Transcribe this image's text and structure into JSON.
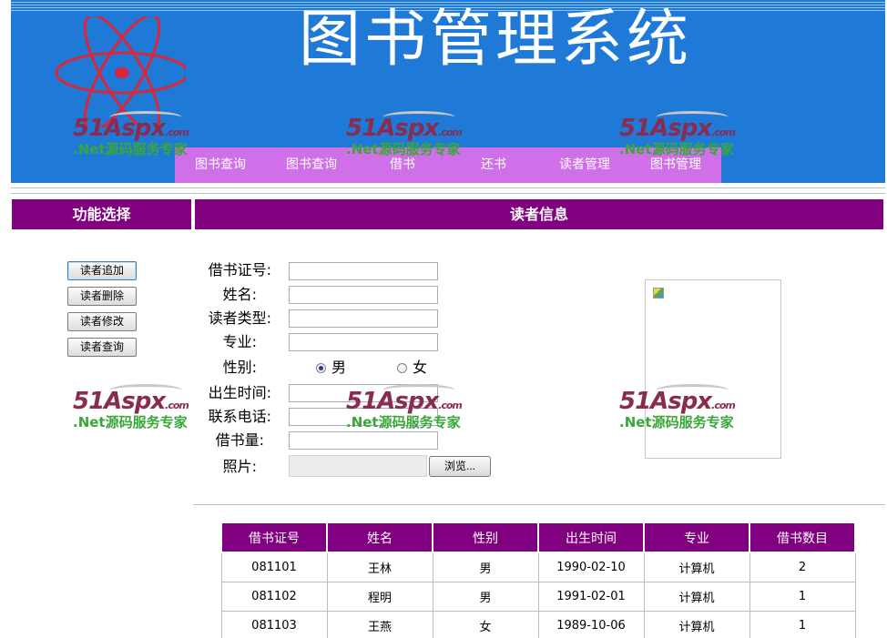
{
  "header": {
    "title": "图书管理系统",
    "nav": [
      "图书查询",
      "图书查询",
      "借书",
      "还书",
      "读者管理",
      "图书管理"
    ]
  },
  "watermark": {
    "brand": "51Aspx",
    "brand_suffix": ".com",
    "tagline": ".Net源码服务专家"
  },
  "left_panel": {
    "title": "功能选择",
    "buttons": [
      "读者追加",
      "读者删除",
      "读者修改",
      "读者查询"
    ]
  },
  "main_panel": {
    "title": "读者信息",
    "labels": {
      "card_no": "借书证号:",
      "name": "姓名:",
      "reader_type": "读者类型:",
      "major": "专业:",
      "gender": "性别:",
      "birth": "出生时间:",
      "phone": "联系电话:",
      "borrow_count": "借书量:",
      "photo": "照片:"
    },
    "gender_options": {
      "male": "男",
      "female": "女",
      "selected": "male"
    },
    "browse_label": "浏览..."
  },
  "table": {
    "columns": [
      "借书证号",
      "姓名",
      "性别",
      "出生时间",
      "专业",
      "借书数目"
    ],
    "rows": [
      [
        "081101",
        "王林",
        "男",
        "1990-02-10",
        "计算机",
        "2"
      ],
      [
        "081102",
        "程明",
        "男",
        "1991-02-01",
        "计算机",
        "1"
      ],
      [
        "081103",
        "王燕",
        "女",
        "1989-10-06",
        "计算机",
        "1"
      ]
    ]
  },
  "colors": {
    "banner": "#1e7ad6",
    "nav": "#d070e8",
    "header_purple": "#800080"
  }
}
